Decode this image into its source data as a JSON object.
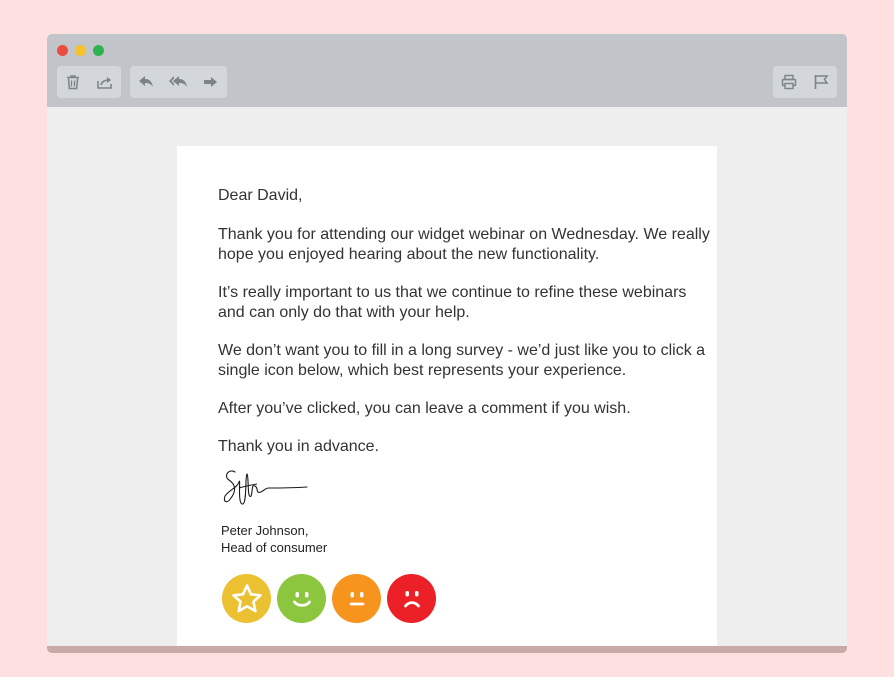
{
  "window": {
    "toolbar": {
      "left_group": [
        "trash-icon",
        "share-icon"
      ],
      "middle_group": [
        "reply-icon",
        "reply-all-icon",
        "forward-icon"
      ],
      "right_group": [
        "print-icon",
        "flag-icon"
      ]
    }
  },
  "email": {
    "greeting": "Dear David,",
    "paragraphs": [
      "Thank you for attending our widget webinar on Wednesday. We really hope you enjoyed hearing about the new functionality.",
      "It’s really important to us that we continue to refine these webinars and can only do that with your help.",
      "We don’t want you to fill in a long survey - we’d just like you to click a single icon below, which best represents your experience.",
      "After you’ve clicked, you can leave a comment if you wish.",
      "Thank you in advance."
    ],
    "signer_name": "Peter Johnson,",
    "signer_title": "Head of consumer",
    "ratings": [
      {
        "icon": "star-icon",
        "color": "#ebc031"
      },
      {
        "icon": "happy-face-icon",
        "color": "#8cc63f"
      },
      {
        "icon": "neutral-face-icon",
        "color": "#f7941d"
      },
      {
        "icon": "sad-face-icon",
        "color": "#ec2027"
      }
    ]
  },
  "colors": {
    "background": "#fde0df",
    "titlebar": "#c1c5ca",
    "window": "#efeeee"
  }
}
